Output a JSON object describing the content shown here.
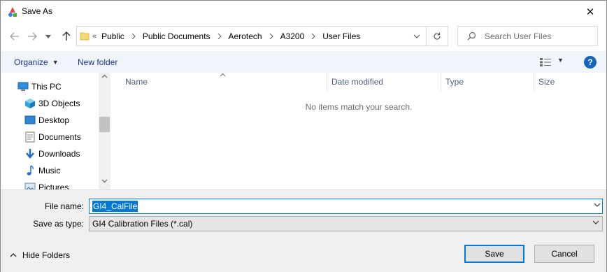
{
  "window": {
    "title": "Save As",
    "close_label": "✕"
  },
  "address": {
    "overflow_glyph": "«",
    "breadcrumbs": [
      "Public",
      "Public Documents",
      "Aerotech",
      "A3200",
      "User Files"
    ]
  },
  "search": {
    "placeholder": "Search User Files"
  },
  "toolbar": {
    "organize_label": "Organize",
    "new_folder_label": "New folder",
    "help_label": "?"
  },
  "nav_pane": {
    "items": [
      {
        "label": "This PC",
        "icon": "computer-icon"
      },
      {
        "label": "3D Objects",
        "icon": "cube-icon"
      },
      {
        "label": "Desktop",
        "icon": "desktop-icon"
      },
      {
        "label": "Documents",
        "icon": "documents-icon"
      },
      {
        "label": "Downloads",
        "icon": "download-icon"
      },
      {
        "label": "Music",
        "icon": "music-icon"
      },
      {
        "label": "Pictures",
        "icon": "pictures-icon"
      }
    ]
  },
  "file_list": {
    "columns": [
      "Name",
      "Date modified",
      "Type",
      "Size"
    ],
    "empty_message": "No items match your search."
  },
  "form": {
    "file_name_label": "File name:",
    "file_name_value": "GI4_CalFile",
    "save_type_label": "Save as type:",
    "save_type_value": "GI4 Calibration Files (*.cal)"
  },
  "footer": {
    "hide_folders_label": "Hide Folders",
    "save_label": "Save",
    "cancel_label": "Cancel"
  },
  "colors": {
    "accent": "#0078d7",
    "toolbar_bg": "#f0f5fb",
    "link_text": "#1e3287"
  }
}
